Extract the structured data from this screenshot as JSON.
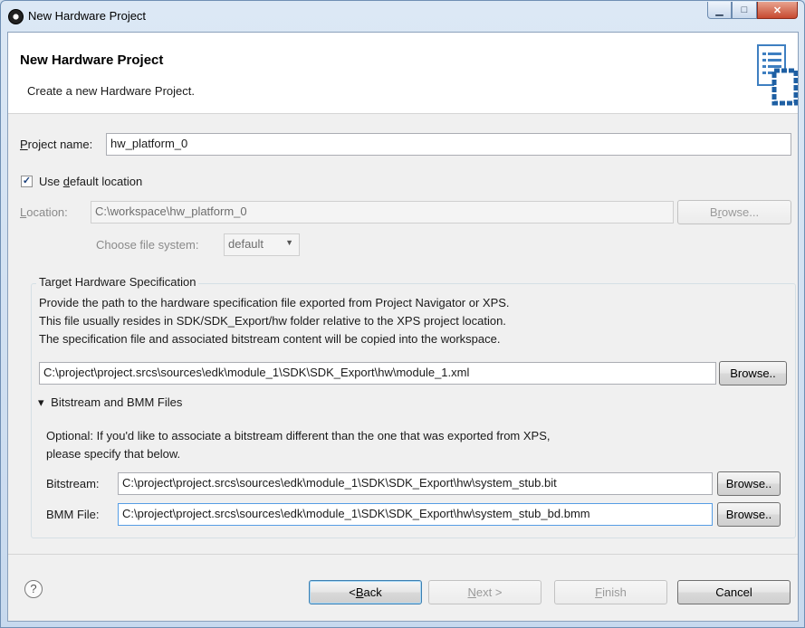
{
  "window": {
    "title": "New Hardware Project",
    "buttons": {
      "minimize": "▁",
      "maximize": "□",
      "close": "✕"
    }
  },
  "header": {
    "title": "New Hardware Project",
    "description": "Create a new Hardware Project."
  },
  "project_name": {
    "label_prefix": "",
    "label_mnemonic": "P",
    "label_rest": "roject name:",
    "value": "hw_platform_0"
  },
  "default_location": {
    "checked": true,
    "check_mark": "✓",
    "label_prefix": "Use ",
    "label_mnemonic": "d",
    "label_rest": "efault location"
  },
  "location": {
    "label_mnemonic": "L",
    "label_rest": "ocation:",
    "value": "C:\\workspace\\hw_platform_0",
    "browse_prefix": "B",
    "browse_mnemonic": "r",
    "browse_rest": "owse..."
  },
  "file_system": {
    "label": "Choose file system:",
    "value": "default",
    "caret": "▼"
  },
  "target_spec": {
    "group_label": "Target Hardware Specification",
    "line1": "Provide the path to the hardware specification file exported from Project Navigator or XPS.",
    "line2": "This file usually resides in SDK/SDK_Export/hw folder relative to the XPS project location.",
    "line3": "The specification file and associated bitstream content will be copied into the workspace.",
    "path": "C:\\project\\project.srcs\\sources\\edk\\module_1\\SDK\\SDK_Export\\hw\\module_1.xml",
    "browse": "Browse.."
  },
  "bitstream_section": {
    "toggle_icon": "▾",
    "title": "Bitstream and BMM Files",
    "optional_line1": "Optional: If you'd like to associate a bitstream different than the one that was exported from XPS,",
    "optional_line2": "please specify that below.",
    "bitstream_label": "Bitstream:",
    "bitstream_value": "C:\\project\\project.srcs\\sources\\edk\\module_1\\SDK\\SDK_Export\\hw\\system_stub.bit",
    "bmm_label": "BMM File:",
    "bmm_value": "C:\\project\\project.srcs\\sources\\edk\\module_1\\SDK\\SDK_Export\\hw\\system_stub_bd.bmm",
    "browse": "Browse.."
  },
  "footer": {
    "help": "?",
    "back_prefix": "< ",
    "back_mnemonic": "B",
    "back_rest": "ack",
    "next_mnemonic": "N",
    "next_rest": "ext >",
    "finish_mnemonic": "F",
    "finish_rest": "inish",
    "cancel": "Cancel"
  }
}
